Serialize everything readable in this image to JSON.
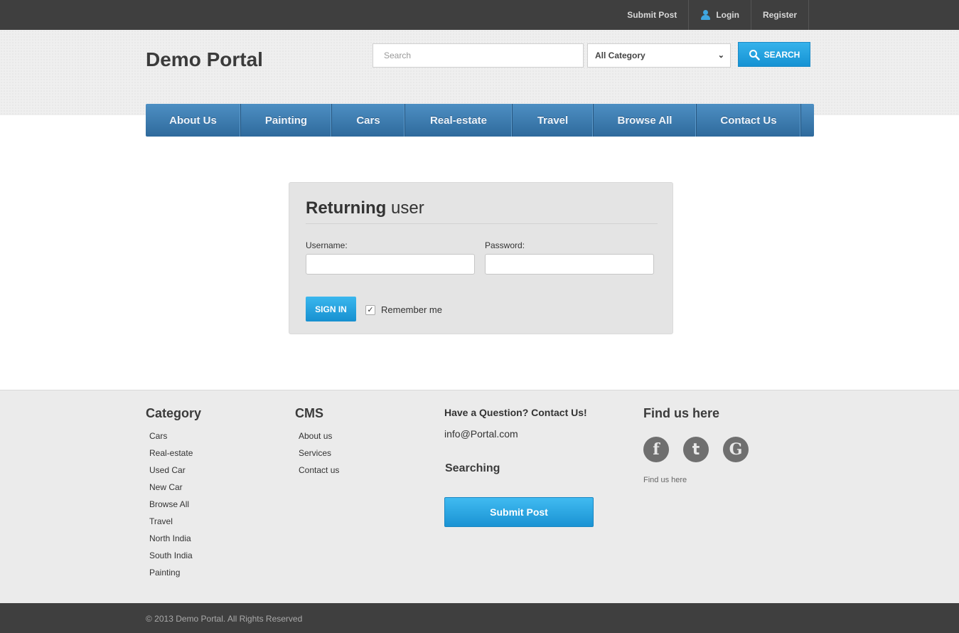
{
  "topbar": {
    "submit_post": "Submit Post",
    "login": "Login",
    "register": "Register"
  },
  "header": {
    "logo": "Demo Portal",
    "search_placeholder": "Search",
    "category_selected": "All Category",
    "search_button": "SEARCH"
  },
  "nav": {
    "items": [
      {
        "label": "About Us"
      },
      {
        "label": "Painting"
      },
      {
        "label": "Cars"
      },
      {
        "label": "Real-estate"
      },
      {
        "label": "Travel"
      },
      {
        "label": "Browse All"
      },
      {
        "label": "Contact Us"
      }
    ]
  },
  "login": {
    "title_strong": "Returning",
    "title_rest": "user",
    "username_label": "Username:",
    "password_label": "Password:",
    "username_value": "",
    "password_value": "",
    "signin_button": "SIGN IN",
    "remember_checked": true,
    "remember_label": "Remember me"
  },
  "footer": {
    "category": {
      "heading": "Category",
      "items": [
        "Cars",
        "Real-estate",
        "Used Car",
        "New Car",
        "Browse All",
        "Travel",
        "North India",
        "South India",
        "Painting"
      ]
    },
    "cms": {
      "heading": "CMS",
      "items": [
        "About us",
        "Services",
        "Contact us"
      ]
    },
    "contact": {
      "heading": "Have a Question? Contact Us!",
      "email": "info@Portal.com",
      "searching_heading": "Searching",
      "submit_button": "Submit Post"
    },
    "find": {
      "heading": "Find us here",
      "icons": [
        "facebook-icon",
        "twitter-icon",
        "google-icon"
      ],
      "caption": "Find us here"
    },
    "copyright": "© 2013 Demo Portal. All Rights Reserved"
  },
  "colors": {
    "accent": "#1e9ad9",
    "nav": "#3d7bb0",
    "topbar": "#3f3f3f"
  }
}
